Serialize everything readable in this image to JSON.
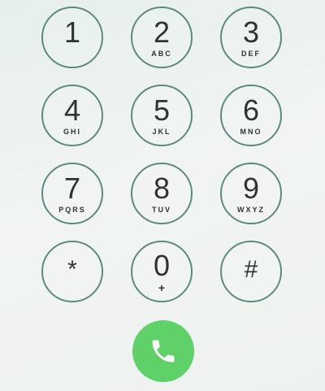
{
  "keypad": {
    "keys": [
      {
        "digit": "1",
        "letters": ""
      },
      {
        "digit": "2",
        "letters": "ABC"
      },
      {
        "digit": "3",
        "letters": "DEF"
      },
      {
        "digit": "4",
        "letters": "GHI"
      },
      {
        "digit": "5",
        "letters": "JKL"
      },
      {
        "digit": "6",
        "letters": "MNO"
      },
      {
        "digit": "7",
        "letters": "PQRS"
      },
      {
        "digit": "8",
        "letters": "TUV"
      },
      {
        "digit": "9",
        "letters": "WXYZ"
      },
      {
        "digit": "*",
        "letters": ""
      },
      {
        "digit": "0",
        "letters": "+"
      },
      {
        "digit": "#",
        "letters": ""
      }
    ]
  },
  "call_button": {
    "icon": "phone-icon",
    "color": "#5fd168"
  },
  "colors": {
    "key_ring": "#5e8a7d",
    "text": "#2f3432",
    "background": "#eef2ef"
  }
}
